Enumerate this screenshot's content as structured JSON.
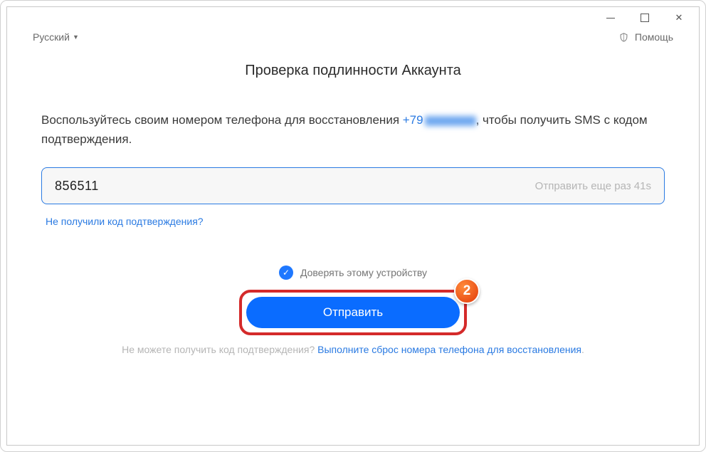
{
  "titlebar": {},
  "topbar": {
    "language": "Русский",
    "help": "Помощь"
  },
  "page": {
    "title": "Проверка подлинности Аккаунта",
    "instruction_pre": "Воспользуйтесь своим номером телефона для восстановления ",
    "phone_prefix": "+79",
    "instruction_post": ", чтобы получить SMS с кодом подтверждения."
  },
  "code": {
    "value": "856511",
    "resend": "Отправить еще раз 41s"
  },
  "links": {
    "not_received": "Не получили код подтверждения?"
  },
  "trust": {
    "label": "Доверять этому устройству"
  },
  "submit": {
    "label": "Отправить",
    "badge": "2"
  },
  "reset": {
    "prompt": "Не можете получить код подтверждения? ",
    "link": "Выполните сброс номера телефона для восстановления",
    "dot": "."
  }
}
